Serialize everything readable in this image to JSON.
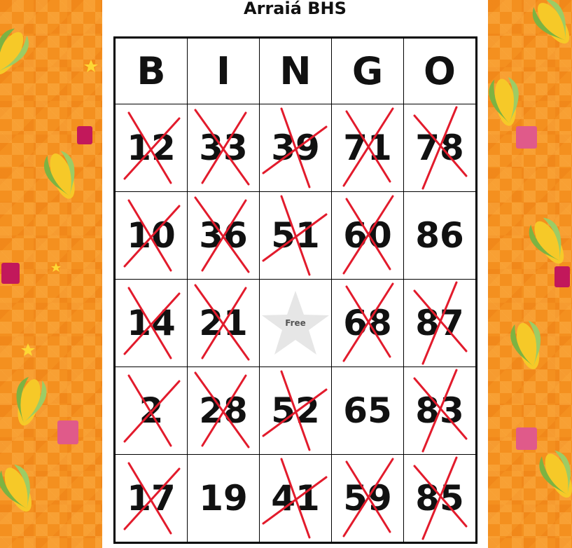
{
  "title": "Arraiá BHS",
  "colors": {
    "mark": "#e21b2c",
    "background": "#f4901f",
    "star": "#e6e6e6"
  },
  "header": [
    "B",
    "I",
    "N",
    "G",
    "O"
  ],
  "free_label": "Free",
  "card": [
    [
      {
        "n": "12",
        "m": true
      },
      {
        "n": "33",
        "m": true
      },
      {
        "n": "39",
        "m": true
      },
      {
        "n": "71",
        "m": true
      },
      {
        "n": "78",
        "m": true
      }
    ],
    [
      {
        "n": "10",
        "m": true
      },
      {
        "n": "36",
        "m": true
      },
      {
        "n": "51",
        "m": true
      },
      {
        "n": "60",
        "m": true
      },
      {
        "n": "86",
        "m": false
      }
    ],
    [
      {
        "n": "14",
        "m": true
      },
      {
        "n": "21",
        "m": true
      },
      {
        "free": true
      },
      {
        "n": "68",
        "m": true
      },
      {
        "n": "87",
        "m": true
      }
    ],
    [
      {
        "n": "2",
        "m": true
      },
      {
        "n": "28",
        "m": true
      },
      {
        "n": "52",
        "m": true
      },
      {
        "n": "65",
        "m": false
      },
      {
        "n": "83",
        "m": true
      }
    ],
    [
      {
        "n": "17",
        "m": true
      },
      {
        "n": "19",
        "m": false
      },
      {
        "n": "41",
        "m": true
      },
      {
        "n": "59",
        "m": true
      },
      {
        "n": "85",
        "m": true
      }
    ]
  ]
}
